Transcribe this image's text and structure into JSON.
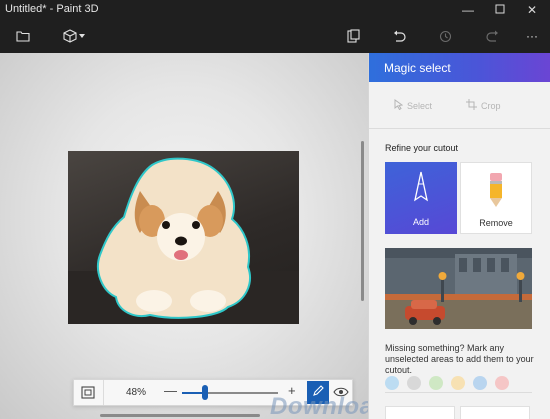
{
  "window": {
    "title": "Untitled* - Paint 3D",
    "minimize_icon": "minimize-icon",
    "maximize_icon": "maximize-icon",
    "close_icon": "close-icon"
  },
  "toolbar": {
    "icons": [
      "folder-icon",
      "cube-icon",
      "chevron-down-icon",
      "paste-icon",
      "undo-icon",
      "history-icon",
      "redo-icon",
      "more-icon"
    ],
    "more_label": "···"
  },
  "canvas": {
    "zoom_percent": "48%",
    "zoom_minus": "—",
    "zoom_plus": "+",
    "zoom_level_fraction": 0.24
  },
  "panel": {
    "title": "Magic select",
    "select_label": "Select",
    "crop_label": "Crop",
    "refine_label": "Refine your cutout",
    "add_label": "Add",
    "remove_label": "Remove",
    "hint": "Missing something? Mark any unselected areas to add them to your cutout.",
    "swatch_colors": [
      "#bcdcf2",
      "#d8d8d8",
      "#cfe8c4",
      "#f7e1b3",
      "#b9d5ef",
      "#f5c6c6"
    ]
  },
  "colors": {
    "accent": "#1a5fb4",
    "panel_header_start": "#2f6fdc",
    "panel_header_end": "#6b45d4"
  },
  "watermark": "Download"
}
